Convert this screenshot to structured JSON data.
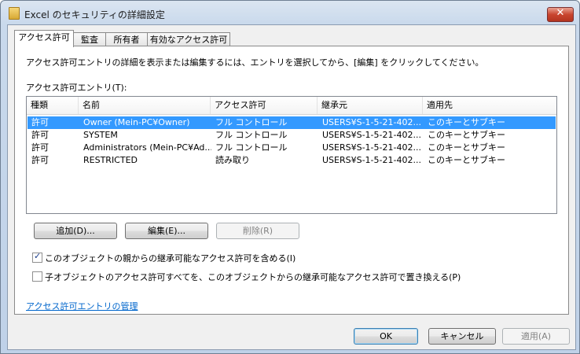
{
  "window": {
    "title": "Excel のセキュリティの詳細設定",
    "close_symbol": "✕"
  },
  "tabs": [
    {
      "label": "アクセス許可",
      "active": true
    },
    {
      "label": "監査",
      "active": false
    },
    {
      "label": "所有者",
      "active": false
    },
    {
      "label": "有効なアクセス許可",
      "active": false
    }
  ],
  "description": "アクセス許可エントリの詳細を表示または編集するには、エントリを選択してから、[編集] をクリックしてください。",
  "entries_label": "アクセス許可エントリ(T):",
  "table": {
    "columns": [
      "種類",
      "名前",
      "アクセス許可",
      "継承元",
      "適用先"
    ],
    "rows": [
      [
        "許可",
        "Owner (Mein-PC¥Owner)",
        "フル コントロール",
        "USERS¥S-1-5-21-402...",
        "このキーとサブキー"
      ],
      [
        "許可",
        "SYSTEM",
        "フル コントロール",
        "USERS¥S-1-5-21-402...",
        "このキーとサブキー"
      ],
      [
        "許可",
        "Administrators (Mein-PC¥Ad...",
        "フル コントロール",
        "USERS¥S-1-5-21-402...",
        "このキーとサブキー"
      ],
      [
        "許可",
        "RESTRICTED",
        "読み取り",
        "USERS¥S-1-5-21-402...",
        "このキーとサブキー"
      ]
    ],
    "selected_row": 0
  },
  "buttons": {
    "add": "追加(D)...",
    "edit": "編集(E)...",
    "remove": "削除(R)"
  },
  "checkboxes": {
    "inherit": {
      "label": "このオブジェクトの親からの継承可能なアクセス許可を含める(I)",
      "checked": true
    },
    "replace": {
      "label": "子オブジェクトのアクセス許可すべてを、このオブジェクトからの継承可能なアクセス許可で置き換える(P)",
      "checked": false
    }
  },
  "manage_link": "アクセス許可エントリの管理",
  "footer": {
    "ok": "OK",
    "cancel": "キャンセル",
    "apply": "適用(A)"
  },
  "colors": {
    "selection": "#3399ff",
    "link": "#0066cc"
  },
  "icons": {
    "title": "folder-icon",
    "check": "checkmark-icon"
  }
}
